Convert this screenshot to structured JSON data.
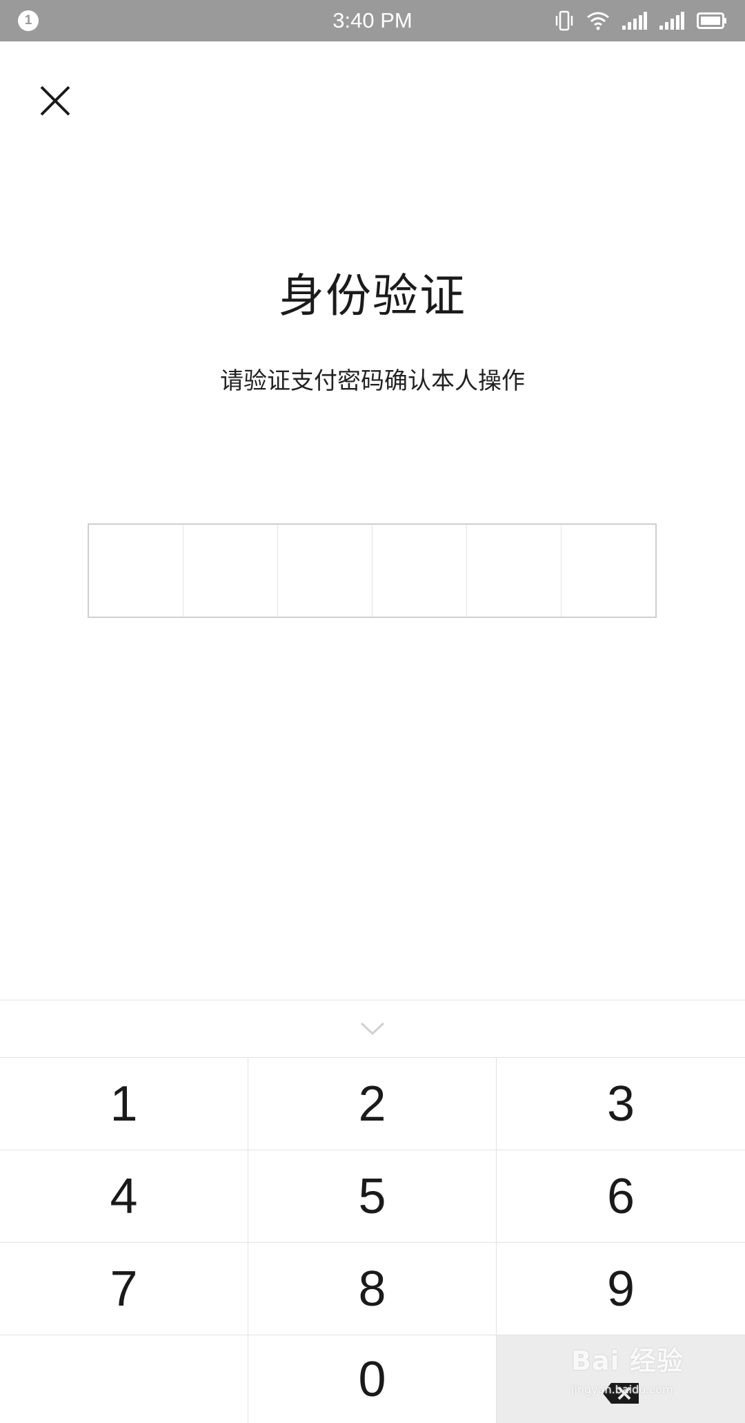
{
  "status_bar": {
    "notification_count": "1",
    "time": "3:40 PM",
    "icons": [
      "vibrate-icon",
      "wifi-icon",
      "signal-1-icon",
      "signal-2-icon",
      "battery-icon"
    ],
    "background": "#9a9a9a"
  },
  "header": {
    "close_icon": "close-icon"
  },
  "title": "身份验证",
  "subtitle": "请验证支付密码确认本人操作",
  "pin": {
    "length": 6,
    "entered": 0
  },
  "keyboard": {
    "collapse_icon": "chevron-down-icon",
    "keys": [
      "1",
      "2",
      "3",
      "4",
      "5",
      "6",
      "7",
      "8",
      "9",
      "",
      "0",
      "delete"
    ],
    "delete_icon": "backspace-icon"
  },
  "watermark": {
    "brand": "Bai 经验",
    "url": "jingyan.baidu.com"
  }
}
